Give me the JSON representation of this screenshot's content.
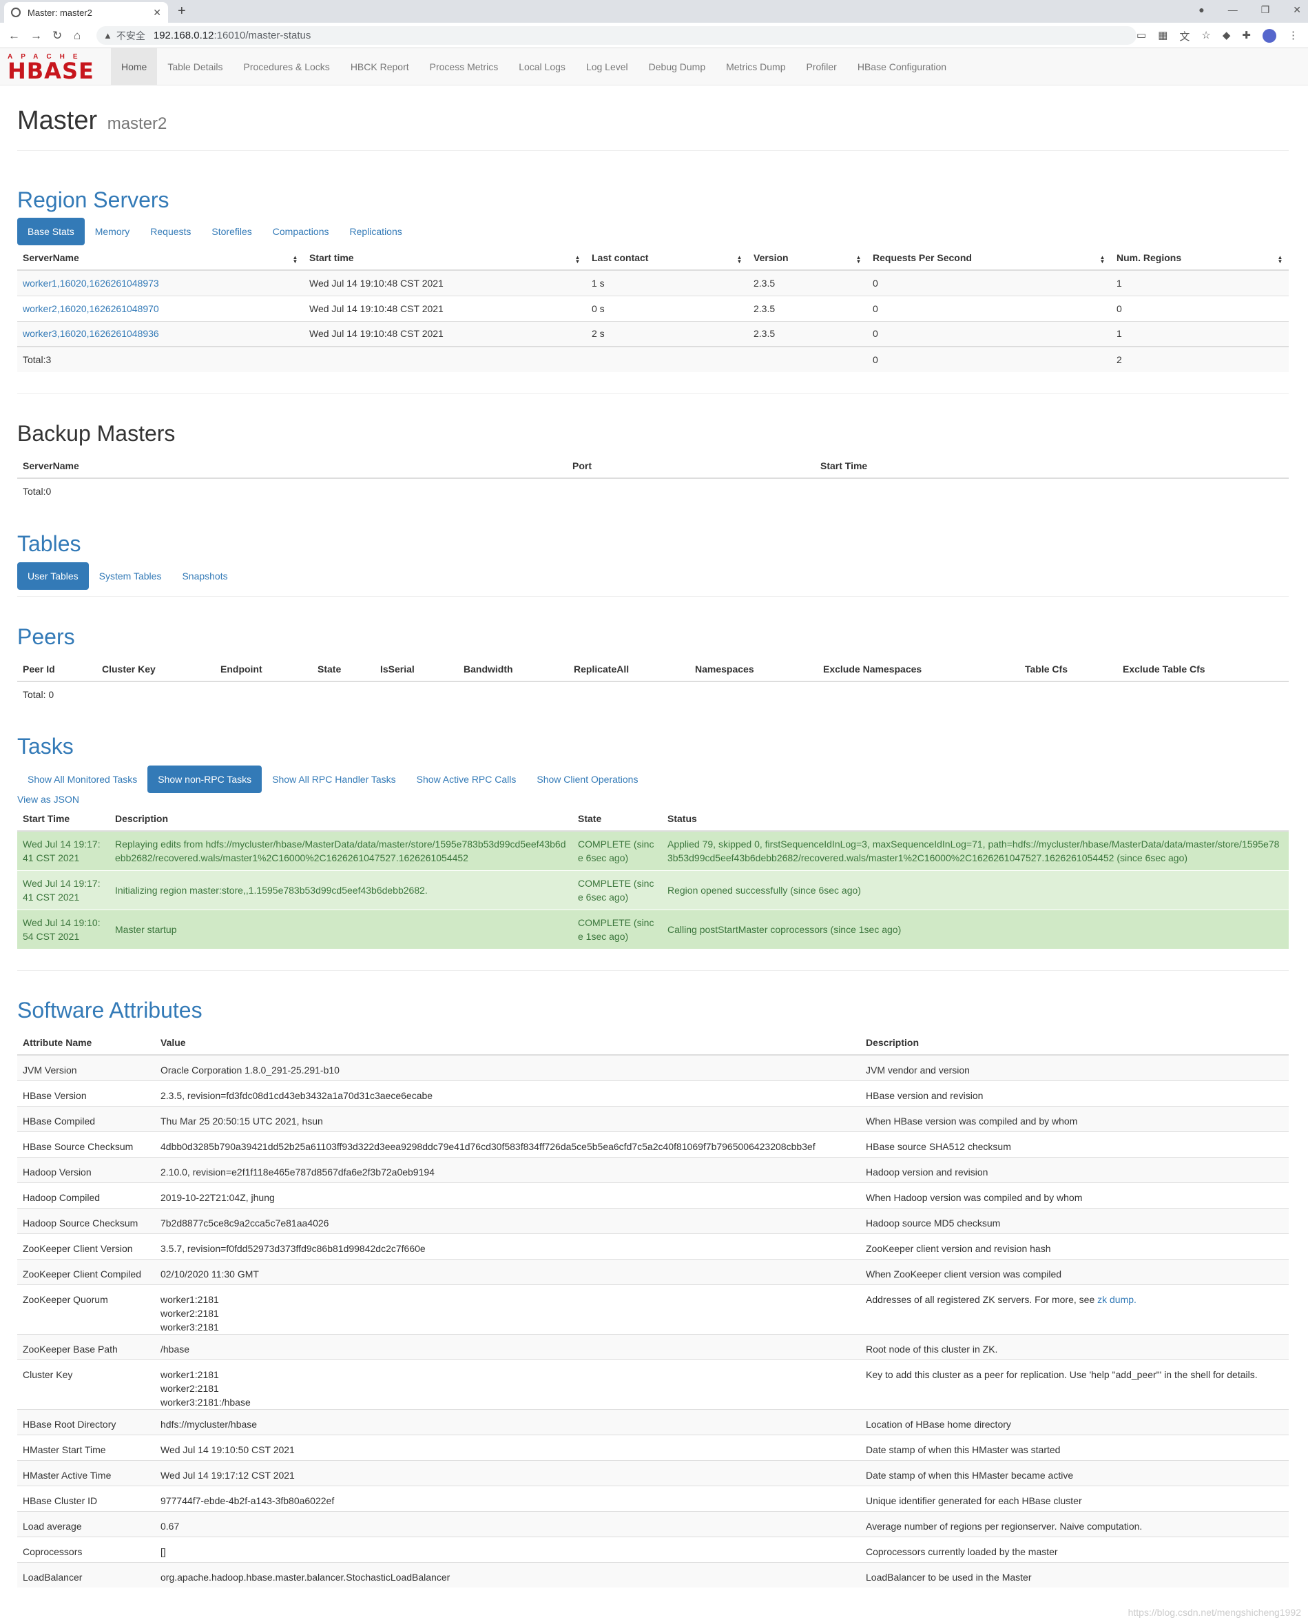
{
  "browser": {
    "tab_title": "Master: master2",
    "new_tab": "+",
    "insecure": "不安全",
    "url_host": "192.168.0.12",
    "url_path": ":16010/master-status"
  },
  "nav": {
    "logo_top": "APACHE",
    "logo_main": "HBASE",
    "items": [
      "Home",
      "Table Details",
      "Procedures & Locks",
      "HBCK Report",
      "Process Metrics",
      "Local Logs",
      "Log Level",
      "Debug Dump",
      "Metrics Dump",
      "Profiler",
      "HBase Configuration"
    ]
  },
  "header": {
    "title": "Master",
    "subtitle": "master2"
  },
  "region_servers": {
    "title": "Region Servers",
    "tabs": [
      "Base Stats",
      "Memory",
      "Requests",
      "Storefiles",
      "Compactions",
      "Replications"
    ],
    "columns": [
      "ServerName",
      "Start time",
      "Last contact",
      "Version",
      "Requests Per Second",
      "Num. Regions"
    ],
    "rows": [
      [
        "worker1,16020,1626261048973",
        "Wed Jul 14 19:10:48 CST 2021",
        "1 s",
        "2.3.5",
        "0",
        "1"
      ],
      [
        "worker2,16020,1626261048970",
        "Wed Jul 14 19:10:48 CST 2021",
        "0 s",
        "2.3.5",
        "0",
        "0"
      ],
      [
        "worker3,16020,1626261048936",
        "Wed Jul 14 19:10:48 CST 2021",
        "2 s",
        "2.3.5",
        "0",
        "1"
      ]
    ],
    "total": [
      "Total:3",
      "",
      "",
      "",
      "0",
      "2"
    ]
  },
  "backup_masters": {
    "title": "Backup Masters",
    "columns": [
      "ServerName",
      "Port",
      "Start Time"
    ],
    "total": "Total:0"
  },
  "tables": {
    "title": "Tables",
    "tabs": [
      "User Tables",
      "System Tables",
      "Snapshots"
    ]
  },
  "peers": {
    "title": "Peers",
    "columns": [
      "Peer Id",
      "Cluster Key",
      "Endpoint",
      "State",
      "IsSerial",
      "Bandwidth",
      "ReplicateAll",
      "Namespaces",
      "Exclude Namespaces",
      "Table Cfs",
      "Exclude Table Cfs"
    ],
    "total": "Total: 0"
  },
  "tasks": {
    "title": "Tasks",
    "tabs": [
      "Show All Monitored Tasks",
      "Show non-RPC Tasks",
      "Show All RPC Handler Tasks",
      "Show Active RPC Calls",
      "Show Client Operations"
    ],
    "json_link": "View as JSON",
    "columns": [
      "Start Time",
      "Description",
      "State",
      "Status"
    ],
    "rows": [
      [
        "Wed Jul 14 19:17:41 CST 2021",
        "Replaying edits from hdfs://mycluster/hbase/MasterData/data/master/store/1595e783b53d99cd5eef43b6debb2682/recovered.wals/master1%2C16000%2C1626261047527.1626261054452",
        "COMPLETE (since 6sec ago)",
        "Applied 79, skipped 0, firstSequenceIdInLog=3, maxSequenceIdInLog=71, path=hdfs://mycluster/hbase/MasterData/data/master/store/1595e783b53d99cd5eef43b6debb2682/recovered.wals/master1%2C16000%2C1626261047527.1626261054452 (since 6sec ago)"
      ],
      [
        "Wed Jul 14 19:17:41 CST 2021",
        "Initializing region master:store,,1.1595e783b53d99cd5eef43b6debb2682.",
        "COMPLETE (since 6sec ago)",
        "Region opened successfully (since 6sec ago)"
      ],
      [
        "Wed Jul 14 19:10:54 CST 2021",
        "Master startup",
        "COMPLETE (since 1sec ago)",
        "Calling postStartMaster coprocessors (since 1sec ago)"
      ]
    ]
  },
  "software": {
    "title": "Software Attributes",
    "columns": [
      "Attribute Name",
      "Value",
      "Description"
    ],
    "rows": [
      [
        "JVM Version",
        "Oracle Corporation 1.8.0_291-25.291-b10",
        "JVM vendor and version"
      ],
      [
        "HBase Version",
        "2.3.5, revision=fd3fdc08d1cd43eb3432a1a70d31c3aece6ecabe",
        "HBase version and revision"
      ],
      [
        "HBase Compiled",
        "Thu Mar 25 20:50:15 UTC 2021, hsun",
        "When HBase version was compiled and by whom"
      ],
      [
        "HBase Source Checksum",
        "4dbb0d3285b790a39421dd52b25a61103ff93d322d3eea9298ddc79e41d76cd30f583f834ff726da5ce5b5ea6cfd7c5a2c40f81069f7b7965006423208cbb3ef",
        "HBase source SHA512 checksum"
      ],
      [
        "Hadoop Version",
        "2.10.0, revision=e2f1f118e465e787d8567dfa6e2f3b72a0eb9194",
        "Hadoop version and revision"
      ],
      [
        "Hadoop Compiled",
        "2019-10-22T21:04Z, jhung",
        "When Hadoop version was compiled and by whom"
      ],
      [
        "Hadoop Source Checksum",
        "7b2d8877c5ce8c9a2cca5c7e81aa4026",
        "Hadoop source MD5 checksum"
      ],
      [
        "ZooKeeper Client Version",
        "3.5.7, revision=f0fdd52973d373ffd9c86b81d99842dc2c7f660e",
        "ZooKeeper client version and revision hash"
      ],
      [
        "ZooKeeper Client Compiled",
        "02/10/2020 11:30 GMT",
        "When ZooKeeper client version was compiled"
      ],
      [
        "ZooKeeper Quorum",
        "worker1:2181\nworker2:2181\nworker3:2181",
        "Addresses of all registered ZK servers. For more, see "
      ],
      [
        "ZooKeeper Base Path",
        "/hbase",
        "Root node of this cluster in ZK."
      ],
      [
        "Cluster Key",
        "worker1:2181\nworker2:2181\nworker3:2181:/hbase",
        "Key to add this cluster as a peer for replication. Use 'help \"add_peer\"' in the shell for details."
      ],
      [
        "HBase Root Directory",
        "hdfs://mycluster/hbase",
        "Location of HBase home directory"
      ],
      [
        "HMaster Start Time",
        "Wed Jul 14 19:10:50 CST 2021",
        "Date stamp of when this HMaster was started"
      ],
      [
        "HMaster Active Time",
        "Wed Jul 14 19:17:12 CST 2021",
        "Date stamp of when this HMaster became active"
      ],
      [
        "HBase Cluster ID",
        "977744f7-ebde-4b2f-a143-3fb80a6022ef",
        "Unique identifier generated for each HBase cluster"
      ],
      [
        "Load average",
        "0.67",
        "Average number of regions per regionserver. Naive computation."
      ],
      [
        "Coprocessors",
        "[]",
        "Coprocessors currently loaded by the master"
      ],
      [
        "LoadBalancer",
        "org.apache.hadoop.hbase.master.balancer.StochasticLoadBalancer",
        "LoadBalancer to be used in the Master"
      ]
    ],
    "zk_dump_link": "zk dump."
  },
  "watermark": "https://blog.csdn.net/mengshicheng1992"
}
